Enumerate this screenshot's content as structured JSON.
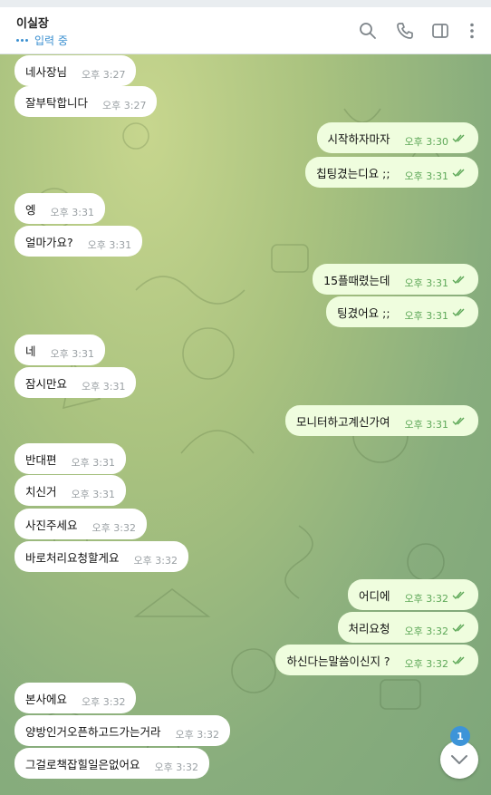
{
  "header": {
    "title": "이실장",
    "status": "입력 중",
    "icons": [
      "search-icon",
      "phone-icon",
      "sidebar-panel-icon",
      "more-vertical-icon"
    ]
  },
  "messages": [
    {
      "dir": "in",
      "text": "네사장님",
      "time": "오후 3:27"
    },
    {
      "dir": "in",
      "text": "잘부탁합니다",
      "time": "오후 3:27"
    },
    {
      "dir": "out",
      "text": "시작하자마자",
      "time": "오후 3:30"
    },
    {
      "dir": "out",
      "text": "칩팅겼는디요 ;;",
      "time": "오후 3:31"
    },
    {
      "dir": "in",
      "text": "엥",
      "time": "오후 3:31"
    },
    {
      "dir": "in",
      "text": "얼마가요?",
      "time": "오후 3:31"
    },
    {
      "dir": "out",
      "text": "15플때렸는데",
      "time": "오후 3:31"
    },
    {
      "dir": "out",
      "text": "팅겼어요 ;;",
      "time": "오후 3:31"
    },
    {
      "dir": "in",
      "text": "네",
      "time": "오후 3:31"
    },
    {
      "dir": "in",
      "text": "잠시만요",
      "time": "오후 3:31"
    },
    {
      "dir": "out",
      "text": "모니터하고계신가여",
      "time": "오후 3:31"
    },
    {
      "dir": "in",
      "text": "반대편",
      "time": "오후 3:31"
    },
    {
      "dir": "in",
      "text": "치신거",
      "time": "오후 3:31"
    },
    {
      "dir": "in",
      "text": "사진주세요",
      "time": "오후 3:32"
    },
    {
      "dir": "in",
      "text": "바로처리요청할게요",
      "time": "오후 3:32"
    },
    {
      "dir": "out",
      "text": "어디에",
      "time": "오후 3:32"
    },
    {
      "dir": "out",
      "text": "처리요청",
      "time": "오후 3:32"
    },
    {
      "dir": "out",
      "text": "하신다는말씀이신지 ?",
      "time": "오후 3:32"
    },
    {
      "dir": "in",
      "text": "본사에요",
      "time": "오후 3:32"
    },
    {
      "dir": "in",
      "text": "양방인거오픈하고드가는거라",
      "time": "오후 3:32"
    },
    {
      "dir": "in",
      "text": "그걸로책잡힐일은없어요",
      "time": "오후 3:32"
    }
  ],
  "unread_count": "1",
  "colors": {
    "incoming_bubble": "#ffffff",
    "outgoing_bubble": "#effdde",
    "accent": "#3a8fd0",
    "read_tick": "#5ea858"
  }
}
